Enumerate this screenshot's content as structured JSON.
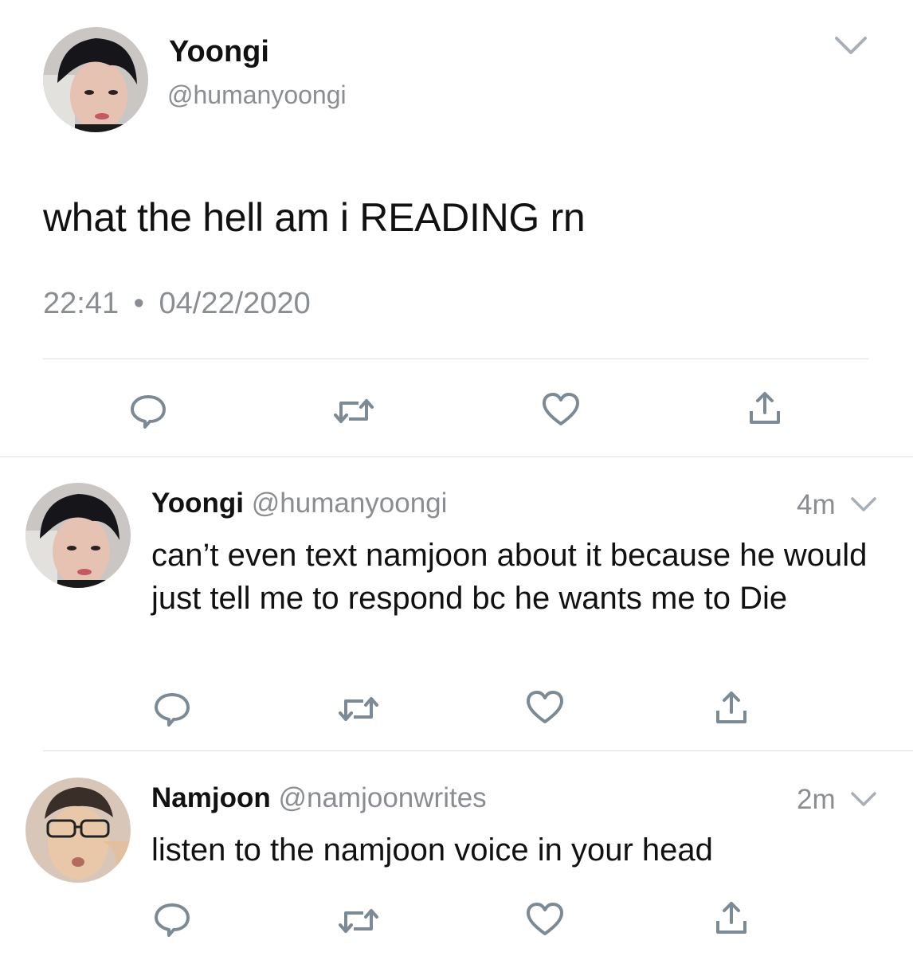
{
  "main_tweet": {
    "display_name": "Yoongi",
    "handle": "@humanyoongi",
    "text": "what the hell am i READING rn",
    "time": "22:41",
    "separator": "•",
    "date": "04/22/2020",
    "menu_icon": "chevron-down-icon",
    "actions": [
      "reply-icon",
      "retweet-icon",
      "like-icon",
      "share-icon"
    ]
  },
  "replies": [
    {
      "display_name": "Yoongi",
      "handle": "@humanyoongi",
      "age": "4m",
      "text": "can’t even text namjoon about it because he would just tell me to respond bc he wants me to Die"
    },
    {
      "display_name": "Namjoon",
      "handle": "@namjoonwrites",
      "age": "2m",
      "text": "listen to the namjoon voice in your head"
    }
  ],
  "colors": {
    "text": "#111111",
    "secondary": "#8a8d91",
    "icon": "#7c8a96",
    "divider": "#dcdfe2"
  }
}
